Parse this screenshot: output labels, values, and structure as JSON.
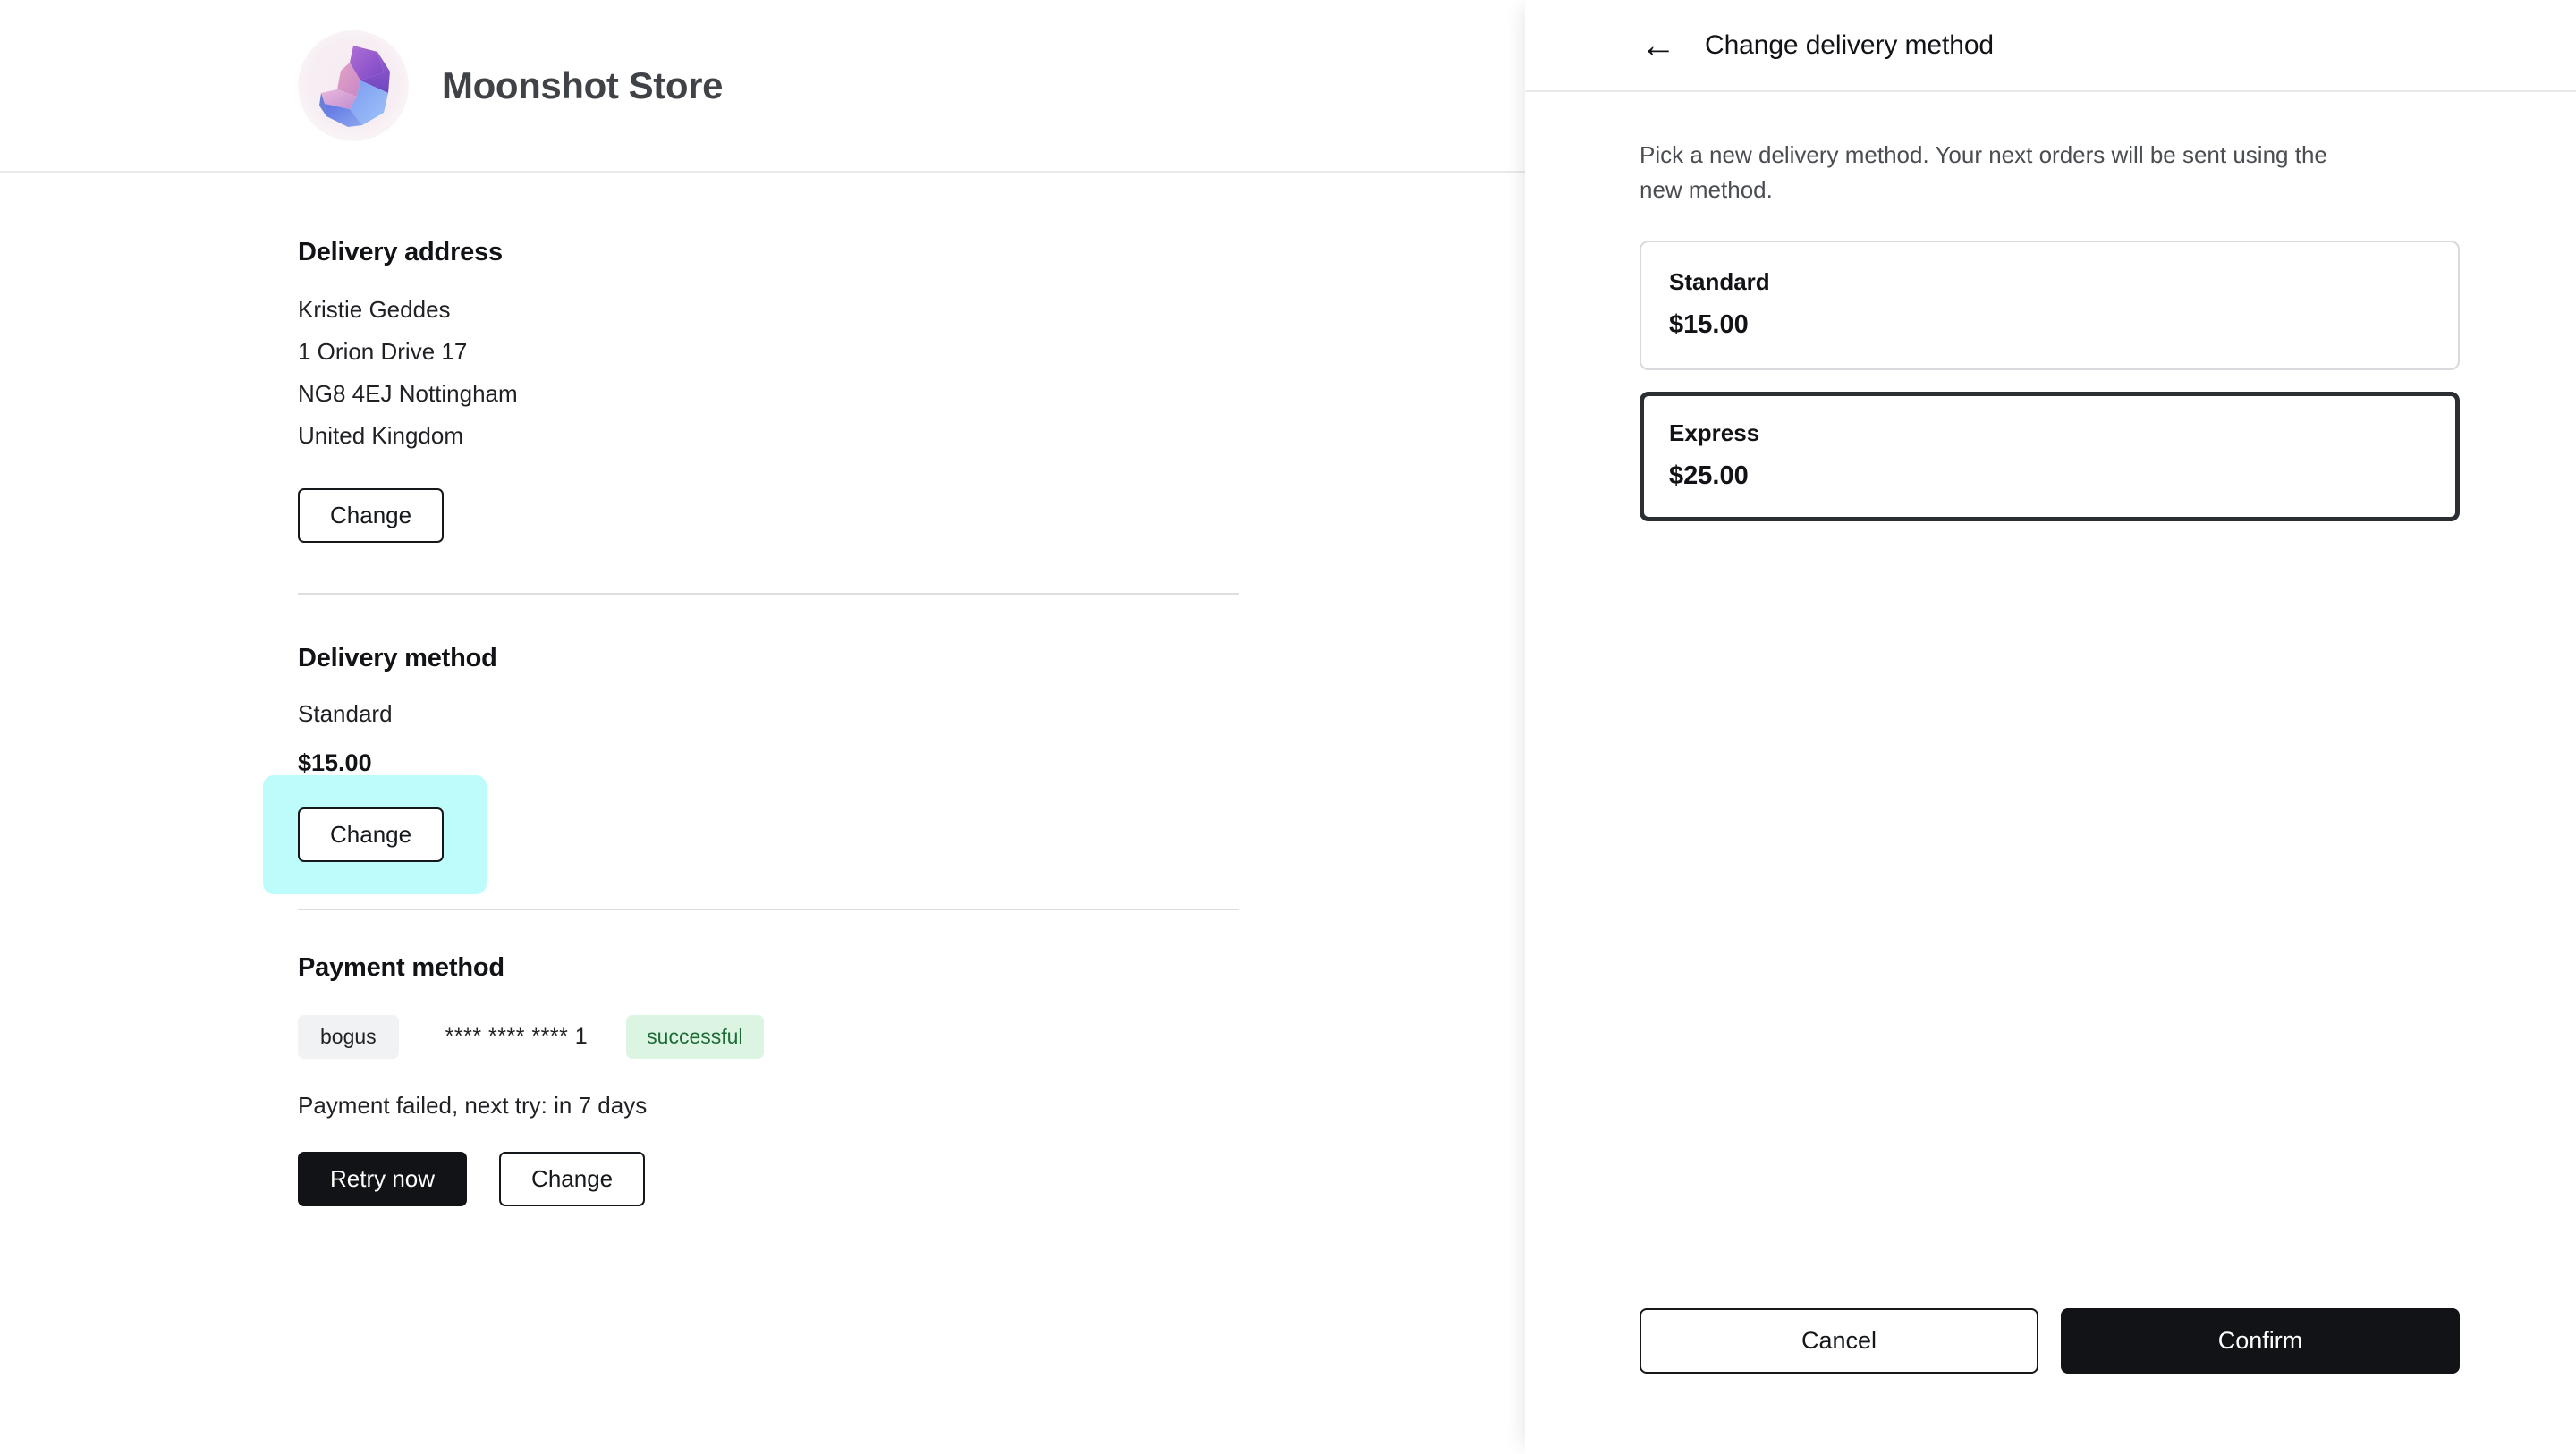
{
  "store": {
    "name": "Moonshot Store",
    "logo_icon": "gem-crystal-icon"
  },
  "left": {
    "delivery_address": {
      "title": "Delivery address",
      "lines": [
        "Kristie Geddes",
        "1 Orion Drive 17",
        "NG8 4EJ Nottingham",
        "United Kingdom"
      ],
      "change_label": "Change"
    },
    "delivery_method": {
      "title": "Delivery method",
      "method_name": "Standard",
      "price": "$15.00",
      "change_label": "Change",
      "highlight_color": "#bdfcfa"
    },
    "payment_method": {
      "title": "Payment method",
      "provider_tag": "bogus",
      "card_mask": "**** **** **** 1",
      "status_badge": "successful",
      "status_badge_color": "#dcf5e3",
      "status_badge_text_color": "#1e6b38",
      "failure_note": "Payment failed, next try: in 7 days",
      "retry_label": "Retry now",
      "change_label": "Change"
    }
  },
  "panel": {
    "back_icon": "arrow-left-icon",
    "back_glyph": "←",
    "title": "Change delivery method",
    "description": "Pick a new delivery method. Your next orders will be sent using the new method.",
    "options": [
      {
        "name": "Standard",
        "price": "$15.00",
        "selected": false
      },
      {
        "name": "Express",
        "price": "$25.00",
        "selected": true
      }
    ],
    "cancel_label": "Cancel",
    "confirm_label": "Confirm"
  }
}
